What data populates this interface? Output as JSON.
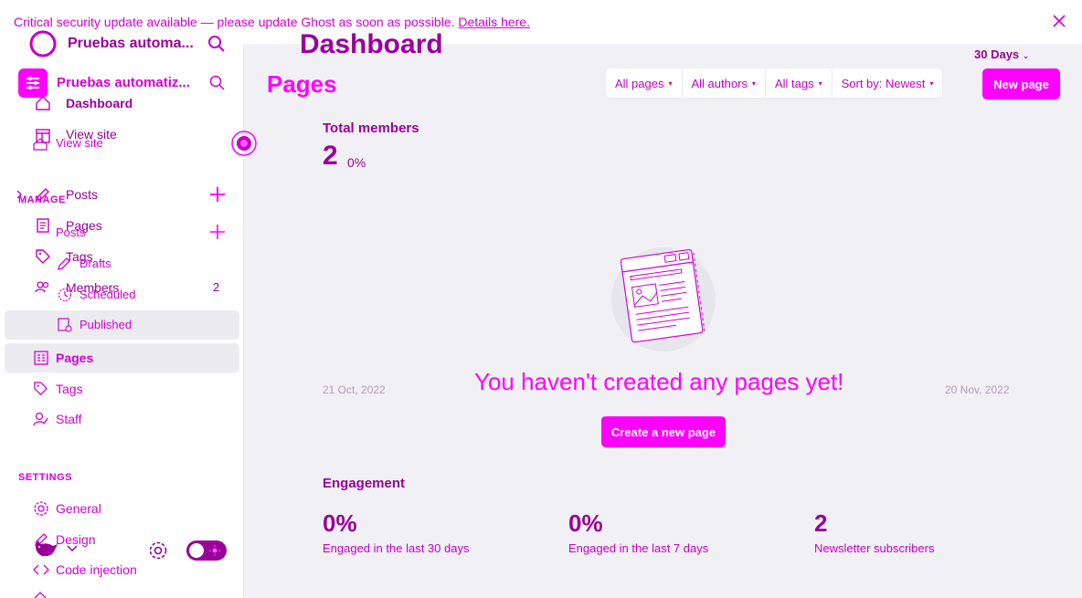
{
  "banner": {
    "text": "Critical security update available — please update Ghost as soon as possible.",
    "link": "Details here."
  },
  "site": {
    "name_a": "Pruebas automa...",
    "name_b": "Pruebas automatiz..."
  },
  "nav": {
    "dashboard": "Dashboard",
    "view_site_a": "View site",
    "view_site_b": "View site",
    "manage_heading": "MANAGE",
    "posts_a": "Posts",
    "posts_b": "Posts",
    "pages_a": "Pages",
    "tags_a": "Tags",
    "drafts": "Drafts",
    "members": "Members",
    "members_count": "2",
    "scheduled": "Scheduled",
    "published": "Published",
    "pages_b": "Pages",
    "tags_b": "Tags",
    "staff": "Staff",
    "settings_heading": "SETTINGS",
    "general": "General",
    "design": "Design",
    "code_injection": "Code injection"
  },
  "header": {
    "dashboard_title": "Dashboard",
    "pages_title": "Pages",
    "range": "30 Days"
  },
  "filters": [
    "All pages",
    "All authors",
    "All tags",
    "Sort by: Newest"
  ],
  "new_page_button": "New page",
  "members": {
    "label": "Total members",
    "value": "2",
    "change": "0%",
    "start_date": "21 Oct, 2022",
    "end_date": "20 Nov, 2022"
  },
  "empty_state": {
    "message": "You haven't created any pages yet!",
    "cta": "Create a new page"
  },
  "engagement": {
    "title": "Engagement",
    "stats": [
      {
        "value": "0%",
        "label": "Engaged in the last 30 days"
      },
      {
        "value": "0%",
        "label": "Engaged in the last 7 days"
      },
      {
        "value": "2",
        "label": "Newsletter subscribers"
      }
    ]
  },
  "colors": {
    "accent": "#ff00ff",
    "text": "#c400c4",
    "dark_accent": "#9a009a"
  }
}
